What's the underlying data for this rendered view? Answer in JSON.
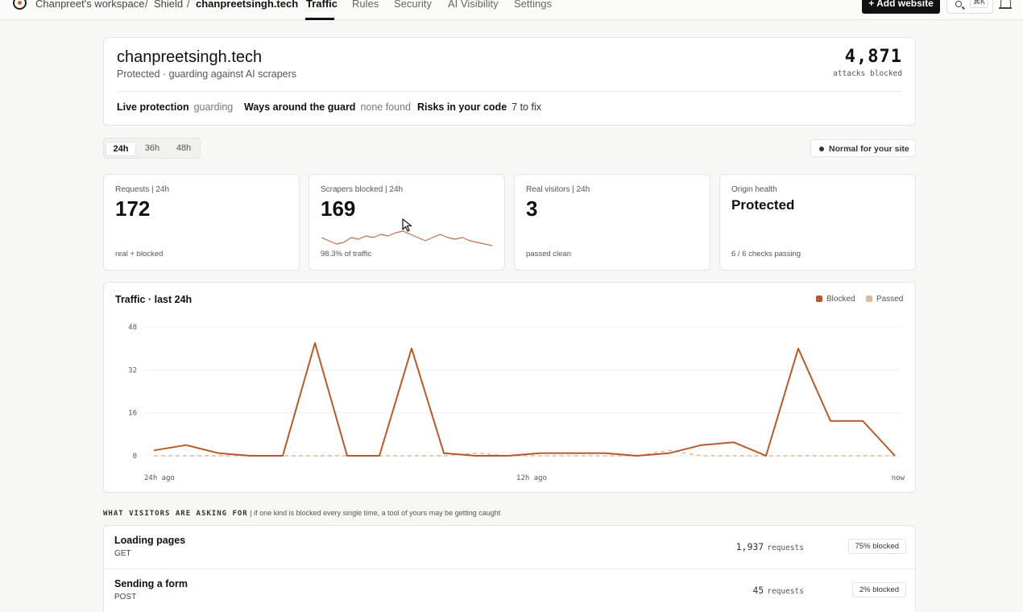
{
  "nav": {
    "workspace": "Chanpreet's workspace",
    "product": "Shield",
    "site": "chanpreetsingh.tech",
    "tabs": [
      "Traffic",
      "Rules",
      "Security",
      "AI Visibility",
      "Settings"
    ],
    "active_tab": "Traffic",
    "add_button": "+ Add website",
    "shortcut": "⌘K"
  },
  "site": {
    "name": "chanpreetsingh.tech",
    "subtitle": "Protected · guarding against AI scrapers",
    "attacks_value": "4,871",
    "attacks_label": "attacks blocked",
    "status": [
      {
        "label": "Live protection",
        "value": "guarding"
      },
      {
        "label": "Ways around the guard",
        "value": "none found"
      },
      {
        "label": "Risks in your code",
        "value": "7 to fix"
      }
    ]
  },
  "range": {
    "options": [
      "24h",
      "36h",
      "48h"
    ],
    "selected": "24h"
  },
  "baseline_badge": "Normal for your site",
  "stats": [
    {
      "label": "Requests | 24h",
      "value": "172",
      "foot": "real + blocked"
    },
    {
      "label": "Scrapers blocked | 24h",
      "value": "169",
      "foot": "98.3% of traffic"
    },
    {
      "label": "Real visitors | 24h",
      "value": "3",
      "foot": "passed clean"
    },
    {
      "label": "Origin health",
      "value": "Protected",
      "foot": "6 / 6 checks passing"
    }
  ],
  "traffic": {
    "title": "Traffic · last 24h",
    "legend": [
      "Blocked",
      "Passed"
    ],
    "x_labels": [
      "24h ago",
      "12h ago",
      "now"
    ],
    "colors": {
      "blocked": "#b65a2e",
      "passed": "#e0b99e"
    }
  },
  "chart_data": {
    "type": "line",
    "title": "Traffic · last 24h",
    "xlabel": "",
    "ylabel": "",
    "ylim": [
      0,
      48
    ],
    "yticks": [
      0,
      16,
      32,
      48
    ],
    "x": [
      0,
      1,
      2,
      3,
      4,
      5,
      6,
      7,
      8,
      9,
      10,
      11,
      12,
      13,
      14,
      15,
      16,
      17,
      18,
      19,
      20,
      21,
      22,
      23
    ],
    "series": [
      {
        "name": "Blocked",
        "values": [
          2,
          4,
          1,
          0,
          0,
          42,
          0,
          0,
          40,
          1,
          0,
          0,
          1,
          1,
          1,
          0,
          1,
          4,
          5,
          0,
          40,
          13,
          13,
          0
        ]
      },
      {
        "name": "Passed",
        "values": [
          0,
          0,
          0,
          0,
          0,
          0,
          0,
          0,
          0,
          0,
          1,
          0,
          0,
          0,
          0,
          0,
          2,
          0,
          0,
          0,
          0,
          0,
          0,
          0
        ]
      }
    ],
    "sparkline": [
      3,
      2,
      1,
      1.5,
      3,
      2.5,
      3.5,
      3,
      4,
      3.5,
      4.5,
      5,
      4,
      3,
      2,
      3,
      4,
      3,
      2.5,
      3,
      2,
      1.5,
      1,
      0.5
    ]
  },
  "requests_section": {
    "heading": "What visitors are asking for",
    "note": "| if one kind is blocked every single time, a tool of yours may be getting caught",
    "rows": [
      {
        "name": "Loading pages",
        "method": "GET",
        "count": "1,937",
        "unit": "requests",
        "badge": "75% blocked"
      },
      {
        "name": "Sending a form",
        "method": "POST",
        "count": "45",
        "unit": "requests",
        "badge": "2% blocked"
      }
    ]
  }
}
